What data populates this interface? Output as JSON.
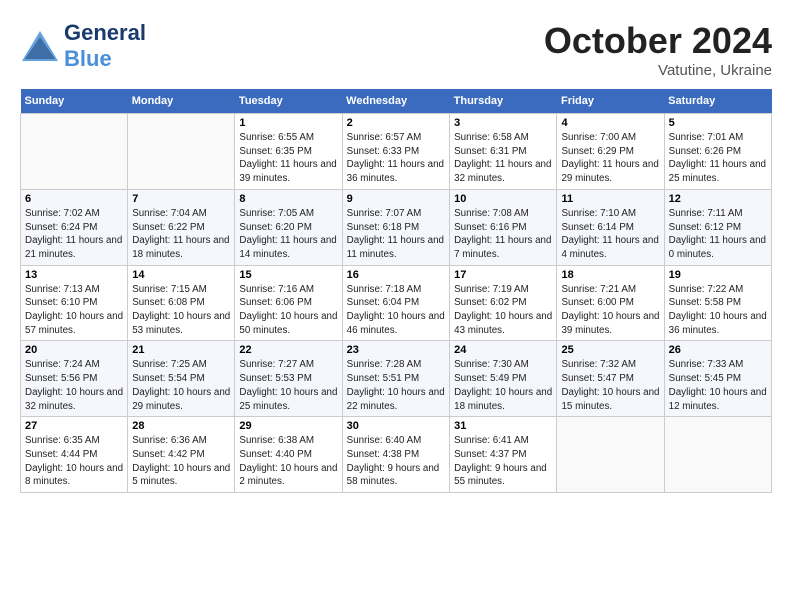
{
  "header": {
    "logo_general": "General",
    "logo_blue": "Blue",
    "month": "October 2024",
    "location": "Vatutine, Ukraine"
  },
  "weekdays": [
    "Sunday",
    "Monday",
    "Tuesday",
    "Wednesday",
    "Thursday",
    "Friday",
    "Saturday"
  ],
  "weeks": [
    [
      {
        "day": "",
        "info": ""
      },
      {
        "day": "",
        "info": ""
      },
      {
        "day": "1",
        "info": "Sunrise: 6:55 AM\nSunset: 6:35 PM\nDaylight: 11 hours and 39 minutes."
      },
      {
        "day": "2",
        "info": "Sunrise: 6:57 AM\nSunset: 6:33 PM\nDaylight: 11 hours and 36 minutes."
      },
      {
        "day": "3",
        "info": "Sunrise: 6:58 AM\nSunset: 6:31 PM\nDaylight: 11 hours and 32 minutes."
      },
      {
        "day": "4",
        "info": "Sunrise: 7:00 AM\nSunset: 6:29 PM\nDaylight: 11 hours and 29 minutes."
      },
      {
        "day": "5",
        "info": "Sunrise: 7:01 AM\nSunset: 6:26 PM\nDaylight: 11 hours and 25 minutes."
      }
    ],
    [
      {
        "day": "6",
        "info": "Sunrise: 7:02 AM\nSunset: 6:24 PM\nDaylight: 11 hours and 21 minutes."
      },
      {
        "day": "7",
        "info": "Sunrise: 7:04 AM\nSunset: 6:22 PM\nDaylight: 11 hours and 18 minutes."
      },
      {
        "day": "8",
        "info": "Sunrise: 7:05 AM\nSunset: 6:20 PM\nDaylight: 11 hours and 14 minutes."
      },
      {
        "day": "9",
        "info": "Sunrise: 7:07 AM\nSunset: 6:18 PM\nDaylight: 11 hours and 11 minutes."
      },
      {
        "day": "10",
        "info": "Sunrise: 7:08 AM\nSunset: 6:16 PM\nDaylight: 11 hours and 7 minutes."
      },
      {
        "day": "11",
        "info": "Sunrise: 7:10 AM\nSunset: 6:14 PM\nDaylight: 11 hours and 4 minutes."
      },
      {
        "day": "12",
        "info": "Sunrise: 7:11 AM\nSunset: 6:12 PM\nDaylight: 11 hours and 0 minutes."
      }
    ],
    [
      {
        "day": "13",
        "info": "Sunrise: 7:13 AM\nSunset: 6:10 PM\nDaylight: 10 hours and 57 minutes."
      },
      {
        "day": "14",
        "info": "Sunrise: 7:15 AM\nSunset: 6:08 PM\nDaylight: 10 hours and 53 minutes."
      },
      {
        "day": "15",
        "info": "Sunrise: 7:16 AM\nSunset: 6:06 PM\nDaylight: 10 hours and 50 minutes."
      },
      {
        "day": "16",
        "info": "Sunrise: 7:18 AM\nSunset: 6:04 PM\nDaylight: 10 hours and 46 minutes."
      },
      {
        "day": "17",
        "info": "Sunrise: 7:19 AM\nSunset: 6:02 PM\nDaylight: 10 hours and 43 minutes."
      },
      {
        "day": "18",
        "info": "Sunrise: 7:21 AM\nSunset: 6:00 PM\nDaylight: 10 hours and 39 minutes."
      },
      {
        "day": "19",
        "info": "Sunrise: 7:22 AM\nSunset: 5:58 PM\nDaylight: 10 hours and 36 minutes."
      }
    ],
    [
      {
        "day": "20",
        "info": "Sunrise: 7:24 AM\nSunset: 5:56 PM\nDaylight: 10 hours and 32 minutes."
      },
      {
        "day": "21",
        "info": "Sunrise: 7:25 AM\nSunset: 5:54 PM\nDaylight: 10 hours and 29 minutes."
      },
      {
        "day": "22",
        "info": "Sunrise: 7:27 AM\nSunset: 5:53 PM\nDaylight: 10 hours and 25 minutes."
      },
      {
        "day": "23",
        "info": "Sunrise: 7:28 AM\nSunset: 5:51 PM\nDaylight: 10 hours and 22 minutes."
      },
      {
        "day": "24",
        "info": "Sunrise: 7:30 AM\nSunset: 5:49 PM\nDaylight: 10 hours and 18 minutes."
      },
      {
        "day": "25",
        "info": "Sunrise: 7:32 AM\nSunset: 5:47 PM\nDaylight: 10 hours and 15 minutes."
      },
      {
        "day": "26",
        "info": "Sunrise: 7:33 AM\nSunset: 5:45 PM\nDaylight: 10 hours and 12 minutes."
      }
    ],
    [
      {
        "day": "27",
        "info": "Sunrise: 6:35 AM\nSunset: 4:44 PM\nDaylight: 10 hours and 8 minutes."
      },
      {
        "day": "28",
        "info": "Sunrise: 6:36 AM\nSunset: 4:42 PM\nDaylight: 10 hours and 5 minutes."
      },
      {
        "day": "29",
        "info": "Sunrise: 6:38 AM\nSunset: 4:40 PM\nDaylight: 10 hours and 2 minutes."
      },
      {
        "day": "30",
        "info": "Sunrise: 6:40 AM\nSunset: 4:38 PM\nDaylight: 9 hours and 58 minutes."
      },
      {
        "day": "31",
        "info": "Sunrise: 6:41 AM\nSunset: 4:37 PM\nDaylight: 9 hours and 55 minutes."
      },
      {
        "day": "",
        "info": ""
      },
      {
        "day": "",
        "info": ""
      }
    ]
  ]
}
